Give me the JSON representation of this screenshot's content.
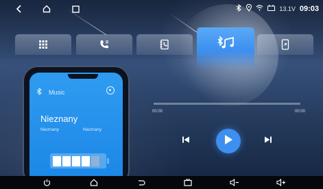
{
  "status_bar": {
    "voltage": "13.1V",
    "clock": "09:03",
    "icons": [
      "bluetooth-icon",
      "location-icon",
      "wifi-icon",
      "car-battery-icon"
    ]
  },
  "top_nav": {
    "back_icon": "back-icon",
    "home_icon": "home-icon",
    "recents_icon": "recents-icon"
  },
  "tabs": [
    {
      "name": "apps",
      "icon": "grid-icon",
      "active": false
    },
    {
      "name": "dialer",
      "icon": "phone-call-icon",
      "active": false
    },
    {
      "name": "contacts",
      "icon": "contacts-book-icon",
      "active": false
    },
    {
      "name": "bluetooth-music",
      "icon": "bluetooth-music-icon",
      "active": true
    },
    {
      "name": "phone-link",
      "icon": "phone-link-icon",
      "active": false
    }
  ],
  "phone": {
    "header_label": "Music",
    "track_title": "Nieznany",
    "artist": "Nieznany",
    "album": "Nieznany",
    "battery_cells_filled": 4,
    "battery_cells_total": 5
  },
  "player": {
    "time_elapsed": "00:00",
    "time_total": "00:00",
    "progress": 0.0
  },
  "bottom_nav": {
    "icons": [
      "power-icon",
      "home-icon",
      "back-icon",
      "recents-icon",
      "volume-down-icon",
      "volume-up-icon"
    ]
  }
}
